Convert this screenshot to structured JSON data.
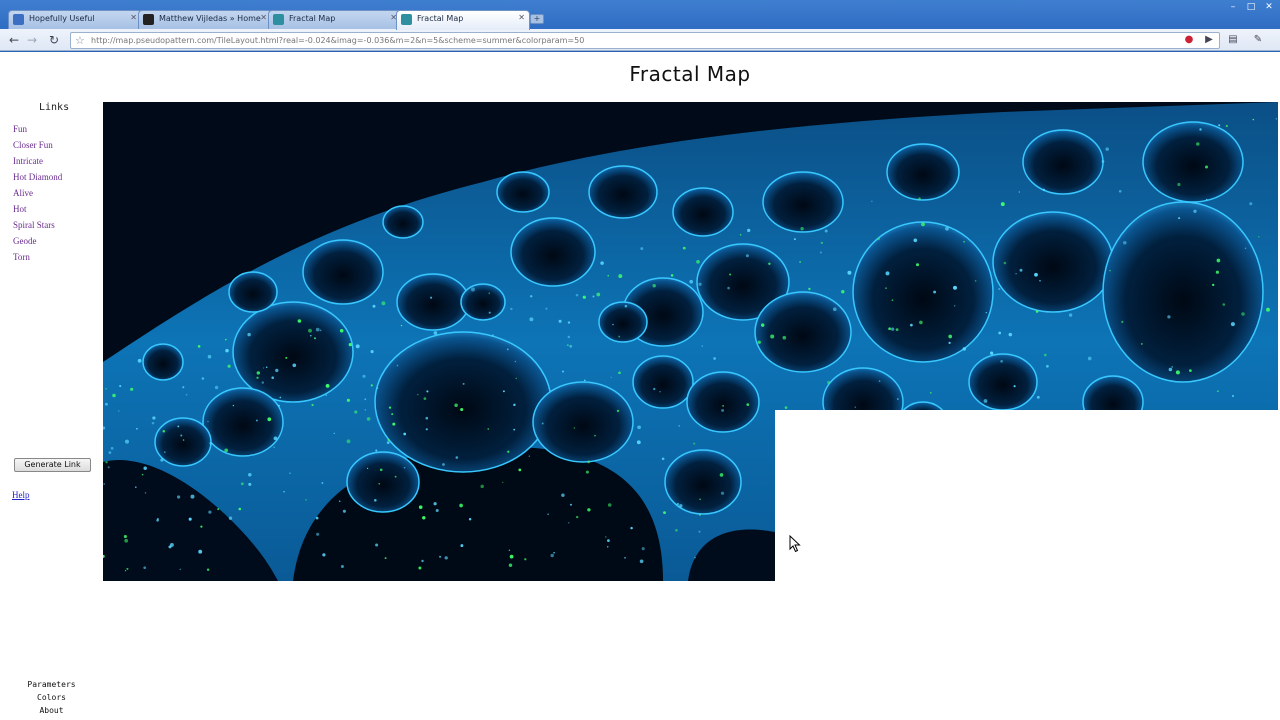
{
  "browser": {
    "tabs": [
      {
        "title": "Hopefully Useful",
        "active": false,
        "favicon_color": "#3a6fc4"
      },
      {
        "title": "Matthew Vijledas » Home",
        "active": false,
        "favicon_color": "#222222"
      },
      {
        "title": "Fractal Map",
        "active": false,
        "favicon_color": "#2d8fa0"
      },
      {
        "title": "Fractal Map",
        "active": true,
        "favicon_color": "#2d8fa0"
      }
    ],
    "url": "http://map.pseudopattern.com/TileLayout.html?real=-0.024&imag=-0.036&m=2&n=5&scheme=summer&colorparam=50",
    "accent": "#2e6bc2"
  },
  "page": {
    "title": "Fractal Map",
    "links_heading": "Links",
    "links": [
      "Fun",
      "Closer Fun",
      "Intricate",
      "Hot Diamond",
      "Alive",
      "Hot",
      "Spiral Stars",
      "Geode",
      "Torn"
    ],
    "generate_button": "Generate Link",
    "help_link": "Help",
    "bottom_menu": [
      "Parameters",
      "Colors",
      "About"
    ],
    "fractal": {
      "colors": {
        "background": "#000a18",
        "deep": "#00203f",
        "mid": "#0a5a9a",
        "edge": "#32c8ff",
        "glow": "#3cff6a"
      }
    }
  }
}
